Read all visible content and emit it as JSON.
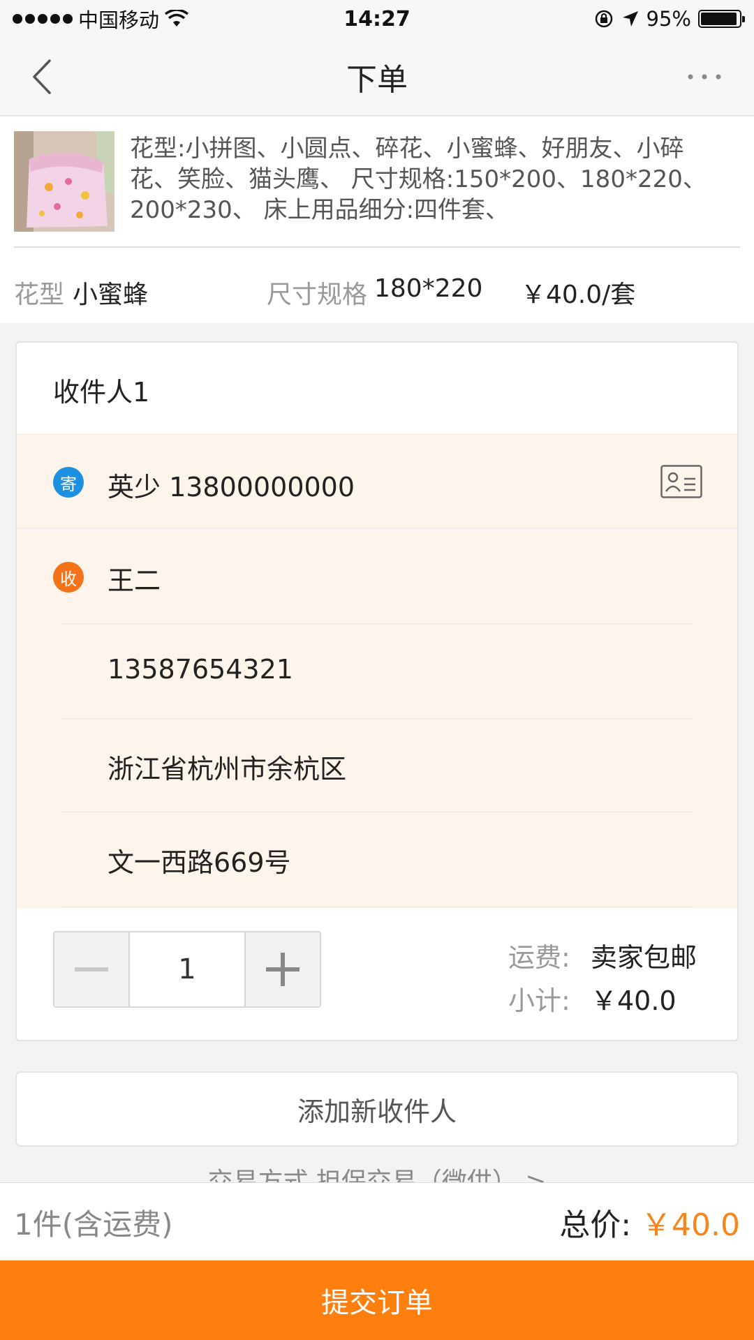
{
  "status_bar": {
    "carrier": "中国移动",
    "time": "14:27",
    "battery": "95%",
    "battery_level": 0.95
  },
  "nav": {
    "title": "下单",
    "back_icon": "chevron-left-icon",
    "more_icon": "more-horizontal-icon"
  },
  "product": {
    "description": "花型:小拼图、小圆点、碎花、小蜜蜂、好朋友、小碎花、笑脸、猫头鹰、 尺寸规格:150*200、180*220、200*230、 床上用品细分:四件套、",
    "pattern_label": "花型",
    "pattern_value": "小蜜蜂",
    "size_label": "尺寸规格",
    "size_value": "180*220",
    "unit_price": "￥40.0/套"
  },
  "receiver_card": {
    "title": "收件人1",
    "sender_badge": "寄",
    "sender": "英少 13800000000",
    "receiver_badge": "收",
    "receiver_name": "王二",
    "receiver_phone": "13587654321",
    "receiver_region": "浙江省杭州市余杭区",
    "receiver_street": "文一西路669号",
    "quantity": "1",
    "shipping_label": "运费:",
    "shipping_value": "卖家包邮",
    "subtotal_label": "小计:",
    "subtotal_value": "￥40.0"
  },
  "add_receiver_label": "添加新收件人",
  "trade_hint": "交易方式  担保交易（微供）  >",
  "summary": {
    "count": "1件(含运费)",
    "total_label": "总价:",
    "total_value": "￥40.0"
  },
  "submit_label": "提交订单",
  "colors": {
    "accent": "#ff7f0e",
    "price": "#f7851a",
    "sender_badge": "#1e90e0",
    "receiver_badge": "#f4731a",
    "highlight_bg": "#fdf4ec"
  }
}
